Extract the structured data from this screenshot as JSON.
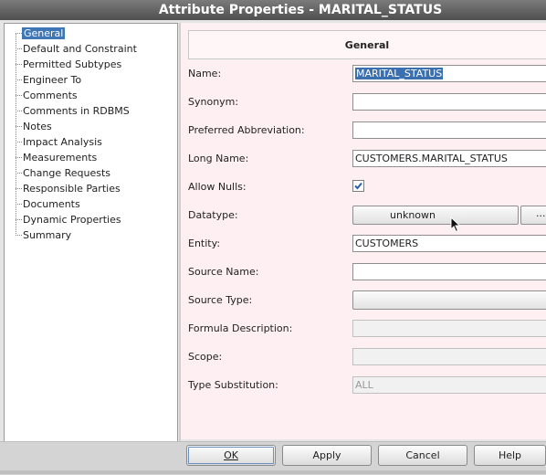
{
  "window": {
    "title": "Attribute Properties - MARITAL_STATUS"
  },
  "tree": {
    "items": [
      {
        "label": "General",
        "selected": true
      },
      {
        "label": "Default and Constraint"
      },
      {
        "label": "Permitted Subtypes"
      },
      {
        "label": "Engineer To"
      },
      {
        "label": "Comments"
      },
      {
        "label": "Comments in RDBMS"
      },
      {
        "label": "Notes"
      },
      {
        "label": "Impact Analysis"
      },
      {
        "label": "Measurements"
      },
      {
        "label": "Change Requests"
      },
      {
        "label": "Responsible Parties"
      },
      {
        "label": "Documents"
      },
      {
        "label": "Dynamic Properties"
      },
      {
        "label": "Summary"
      }
    ]
  },
  "panel": {
    "header": "General",
    "name": {
      "label": "Name:",
      "value": "MARITAL_STATUS"
    },
    "synonym": {
      "label": "Synonym:",
      "value": ""
    },
    "preferred_abbreviation": {
      "label": "Preferred Abbreviation:",
      "value": ""
    },
    "long_name": {
      "label": "Long Name:",
      "value": "CUSTOMERS.MARITAL_STATUS"
    },
    "allow_nulls": {
      "label": "Allow Nulls:",
      "checked": true
    },
    "datatype": {
      "label": "Datatype:",
      "value": "unknown",
      "more": "..."
    },
    "entity": {
      "label": "Entity:",
      "value": "CUSTOMERS"
    },
    "source_name": {
      "label": "Source Name:",
      "value": ""
    },
    "source_type": {
      "label": "Source Type:",
      "value": ""
    },
    "formula_description": {
      "label": "Formula Description:",
      "value": ""
    },
    "scope": {
      "label": "Scope:",
      "value": ""
    },
    "type_substitution": {
      "label": "Type Substitution:",
      "value": "ALL"
    }
  },
  "buttons": {
    "ok": "OK",
    "apply": "Apply",
    "cancel": "Cancel",
    "help": "Help"
  },
  "icons": {
    "check": "checkmark-icon",
    "cursor": "mouse-pointer-icon"
  },
  "colors": {
    "selection": "#3f76b6",
    "panel_bg": "#fdeff2",
    "titlebar": "#5a5a5a"
  }
}
